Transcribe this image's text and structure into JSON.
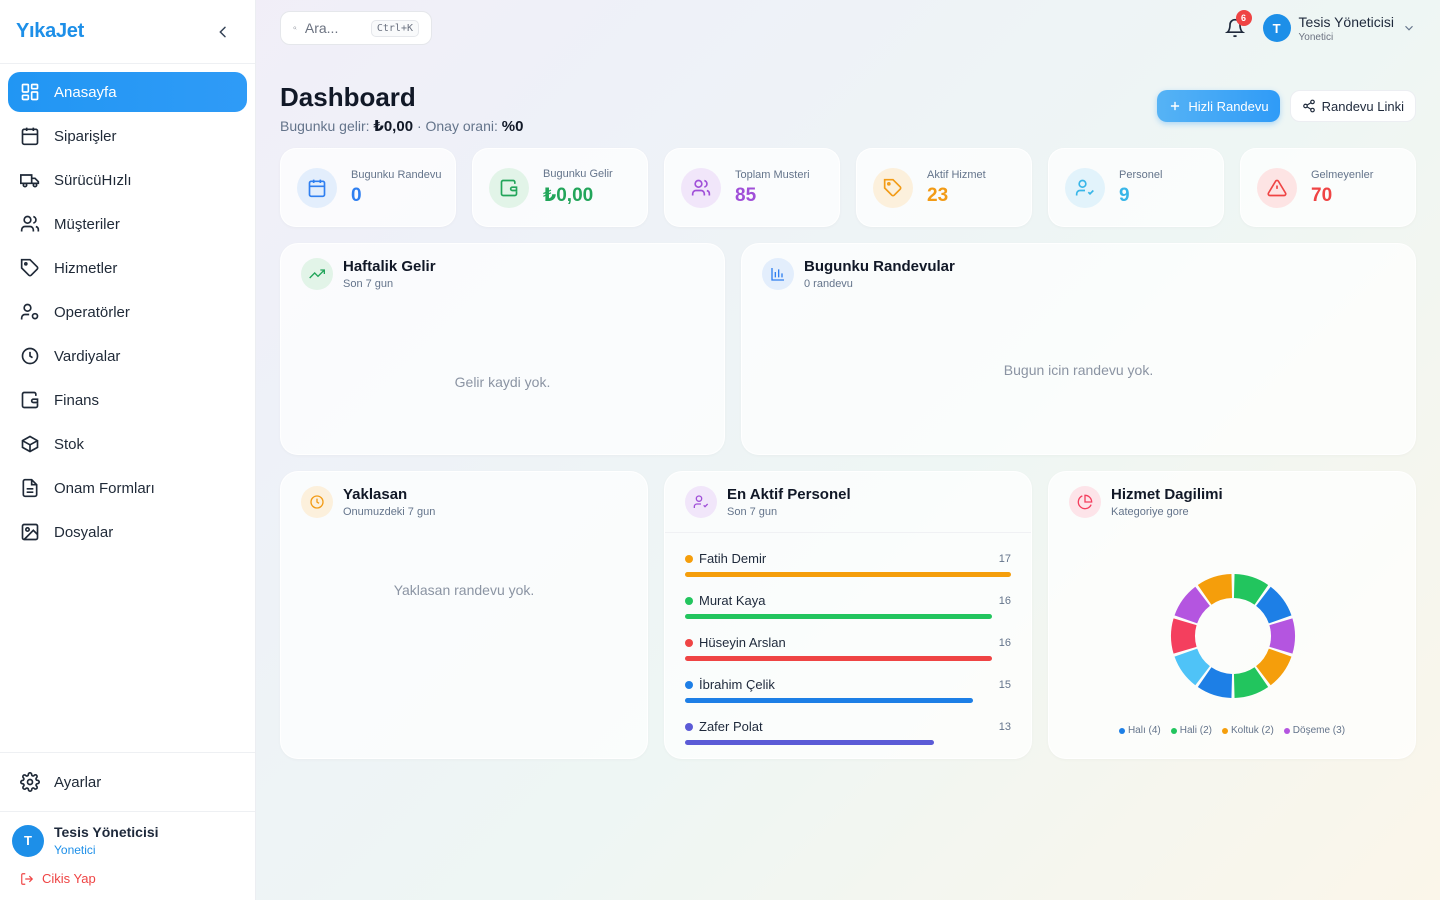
{
  "brand": {
    "name": "YıkaJet"
  },
  "sidebar": {
    "items": [
      {
        "label": "Anasayfa",
        "icon": "dashboard-icon"
      },
      {
        "label": "Siparişler",
        "icon": "calendar-icon"
      },
      {
        "label": "SürücüHızlı",
        "icon": "truck-icon"
      },
      {
        "label": "Müşteriler",
        "icon": "users-icon"
      },
      {
        "label": "Hizmetler",
        "icon": "tag-icon"
      },
      {
        "label": "Operatörler",
        "icon": "user-cog-icon"
      },
      {
        "label": "Vardiyalar",
        "icon": "clock-icon"
      },
      {
        "label": "Finans",
        "icon": "wallet-icon"
      },
      {
        "label": "Stok",
        "icon": "package-icon"
      },
      {
        "label": "Onam Formları",
        "icon": "file-text-icon"
      },
      {
        "label": "Dosyalar",
        "icon": "image-icon"
      }
    ],
    "settings_label": "Ayarlar",
    "user": {
      "initial": "T",
      "name": "Tesis Yöneticisi",
      "role": "Yonetici"
    },
    "logout_label": "Cikis Yap"
  },
  "topbar": {
    "search_placeholder": "Ara...",
    "search_shortcut": "Ctrl+K",
    "notification_count": "6",
    "user": {
      "initial": "T",
      "name": "Tesis Yöneticisi",
      "role": "Yonetici"
    }
  },
  "header": {
    "title": "Dashboard",
    "income_label": "Bugunku gelir:",
    "income_value": "₺0,00",
    "approval_label": "· Onay orani:",
    "approval_value": "%0",
    "quick_button": "Hizli Randevu",
    "link_button": "Randevu Linki"
  },
  "stats": [
    {
      "label": "Bugunku Randevu",
      "value": "0",
      "color": "#2f7ff0",
      "bg": "#e3eefc"
    },
    {
      "label": "Bugunku Gelir",
      "value": "₺0,00",
      "color": "#22a55a",
      "bg": "#e2f4e8"
    },
    {
      "label": "Toplam Musteri",
      "value": "85",
      "color": "#a04fd8",
      "bg": "#f1e6fa"
    },
    {
      "label": "Aktif Hizmet",
      "value": "23",
      "color": "#f29b16",
      "bg": "#fcf0dc"
    },
    {
      "label": "Personel",
      "value": "9",
      "color": "#38b6e8",
      "bg": "#e2f3fb"
    },
    {
      "label": "Gelmeyenler",
      "value": "70",
      "color": "#ef4444",
      "bg": "#fde4e4"
    }
  ],
  "weekly": {
    "title": "Haftalik Gelir",
    "subtitle": "Son 7 gun",
    "empty": "Gelir kaydi yok."
  },
  "today": {
    "title": "Bugunku Randevular",
    "subtitle": "0 randevu",
    "empty": "Bugun icin randevu yok."
  },
  "upcoming": {
    "title": "Yaklasan",
    "subtitle": "Onumuzdeki 7 gun",
    "empty": "Yaklasan randevu yok."
  },
  "staff": {
    "title": "En Aktif Personel",
    "subtitle": "Son 7 gun",
    "items": [
      {
        "name": "Fatih Demir",
        "count": 17,
        "color": "#f59e0b"
      },
      {
        "name": "Murat Kaya",
        "count": 16,
        "color": "#22c55e"
      },
      {
        "name": "Hüseyin Arslan",
        "count": 16,
        "color": "#ef4444"
      },
      {
        "name": "İbrahim Çelik",
        "count": 15,
        "color": "#1d7fe6"
      },
      {
        "name": "Zafer Polat",
        "count": 13,
        "color": "#5b5bd6"
      }
    ]
  },
  "services": {
    "title": "Hizmet Dagilimi",
    "subtitle": "Kategoriye gore",
    "legend": [
      {
        "label": "Halı (4)",
        "color": "#1d7fe6"
      },
      {
        "label": "Hali (2)",
        "color": "#22c55e"
      },
      {
        "label": "Koltuk (2)",
        "color": "#f59e0b"
      },
      {
        "label": "Döşeme (3)",
        "color": "#b455e0"
      }
    ],
    "segment_colors": [
      "#22c55e",
      "#1d7fe6",
      "#b455e0",
      "#f59e0b",
      "#22c55e",
      "#1d7fe6",
      "#4fc3f7",
      "#f43f5e",
      "#b455e0",
      "#f59e0b"
    ]
  }
}
